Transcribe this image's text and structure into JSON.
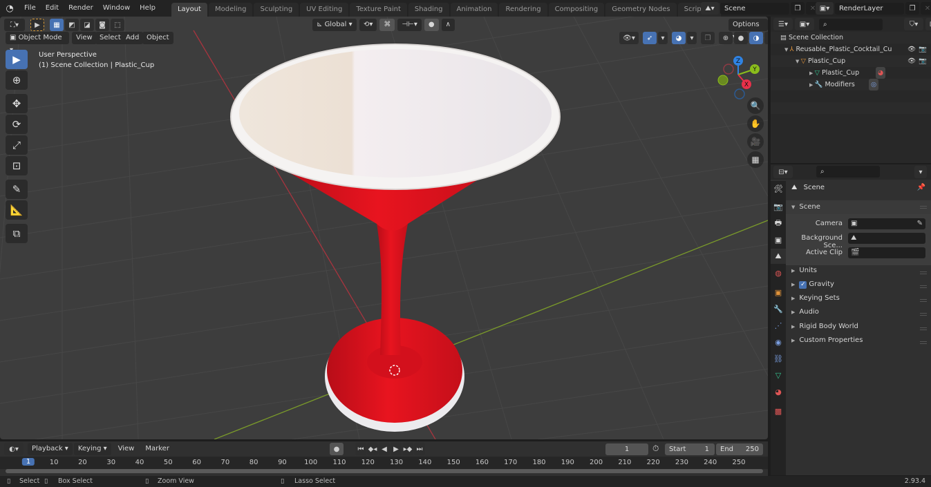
{
  "topbar": {
    "menus": [
      "File",
      "Edit",
      "Render",
      "Window",
      "Help"
    ],
    "workspaces": [
      "Layout",
      "Modeling",
      "Sculpting",
      "UV Editing",
      "Texture Paint",
      "Shading",
      "Animation",
      "Rendering",
      "Compositing",
      "Geometry Nodes",
      "Scripting"
    ],
    "active_workspace": "Layout",
    "add_tab": "+",
    "scene_name": "Scene",
    "view_layer_name": "RenderLayer"
  },
  "viewport": {
    "mode": "Object Mode",
    "menus": [
      "View",
      "Select",
      "Add",
      "Object"
    ],
    "transform_orientation": "Global",
    "options_label": "Options",
    "perspective_label": "User Perspective",
    "context_label": "(1) Scene Collection | Plastic_Cup",
    "gizmo": {
      "x": "X",
      "y": "Y",
      "z": "Z"
    },
    "colors": {
      "x_axis": "#e8304a",
      "y_axis": "#8bbd1c",
      "z_axis": "#2f83e4",
      "cup_red": "#e2141f",
      "cup_white": "#f2efec",
      "bg": "#3d3d3d"
    }
  },
  "toolbar": {
    "tools": [
      "select-box",
      "cursor",
      "move",
      "rotate",
      "scale",
      "transform",
      "annotate",
      "measure",
      "add-cube"
    ]
  },
  "outliner": {
    "search_placeholder": "",
    "root": "Scene Collection",
    "items": [
      {
        "label": "Reusable_Plastic_Cocktail_Cu",
        "depth": 1,
        "icon": "empty-icon"
      },
      {
        "label": "Plastic_Cup",
        "depth": 2,
        "icon": "object-icon"
      },
      {
        "label": "Plastic_Cup",
        "depth": 3,
        "icon": "mesh-data-icon"
      },
      {
        "label": "Modifiers",
        "depth": 3,
        "icon": "wrench-icon"
      }
    ]
  },
  "properties": {
    "context": "Scene",
    "panel": "Scene",
    "fields": [
      {
        "label": "Camera",
        "value": ""
      },
      {
        "label": "Background Sce...",
        "value": ""
      },
      {
        "label": "Active Clip",
        "value": ""
      }
    ],
    "sections": [
      "Units",
      "Gravity",
      "Keying Sets",
      "Audio",
      "Rigid Body World",
      "Custom Properties"
    ],
    "gravity_checked": true
  },
  "timeline": {
    "menus": [
      "Playback",
      "Keying",
      "View",
      "Marker"
    ],
    "current_frame": "1",
    "start_label": "Start",
    "start": "1",
    "end_label": "End",
    "end": "250",
    "ticks": [
      "1",
      "10",
      "20",
      "30",
      "40",
      "50",
      "60",
      "70",
      "80",
      "90",
      "100",
      "110",
      "120",
      "130",
      "140",
      "150",
      "160",
      "170",
      "180",
      "190",
      "200",
      "210",
      "220",
      "230",
      "240",
      "250"
    ]
  },
  "statusbar": {
    "select": "Select",
    "box_select": "Box Select",
    "zoom_view": "Zoom View",
    "lasso_select": "Lasso Select",
    "version": "2.93.4"
  }
}
